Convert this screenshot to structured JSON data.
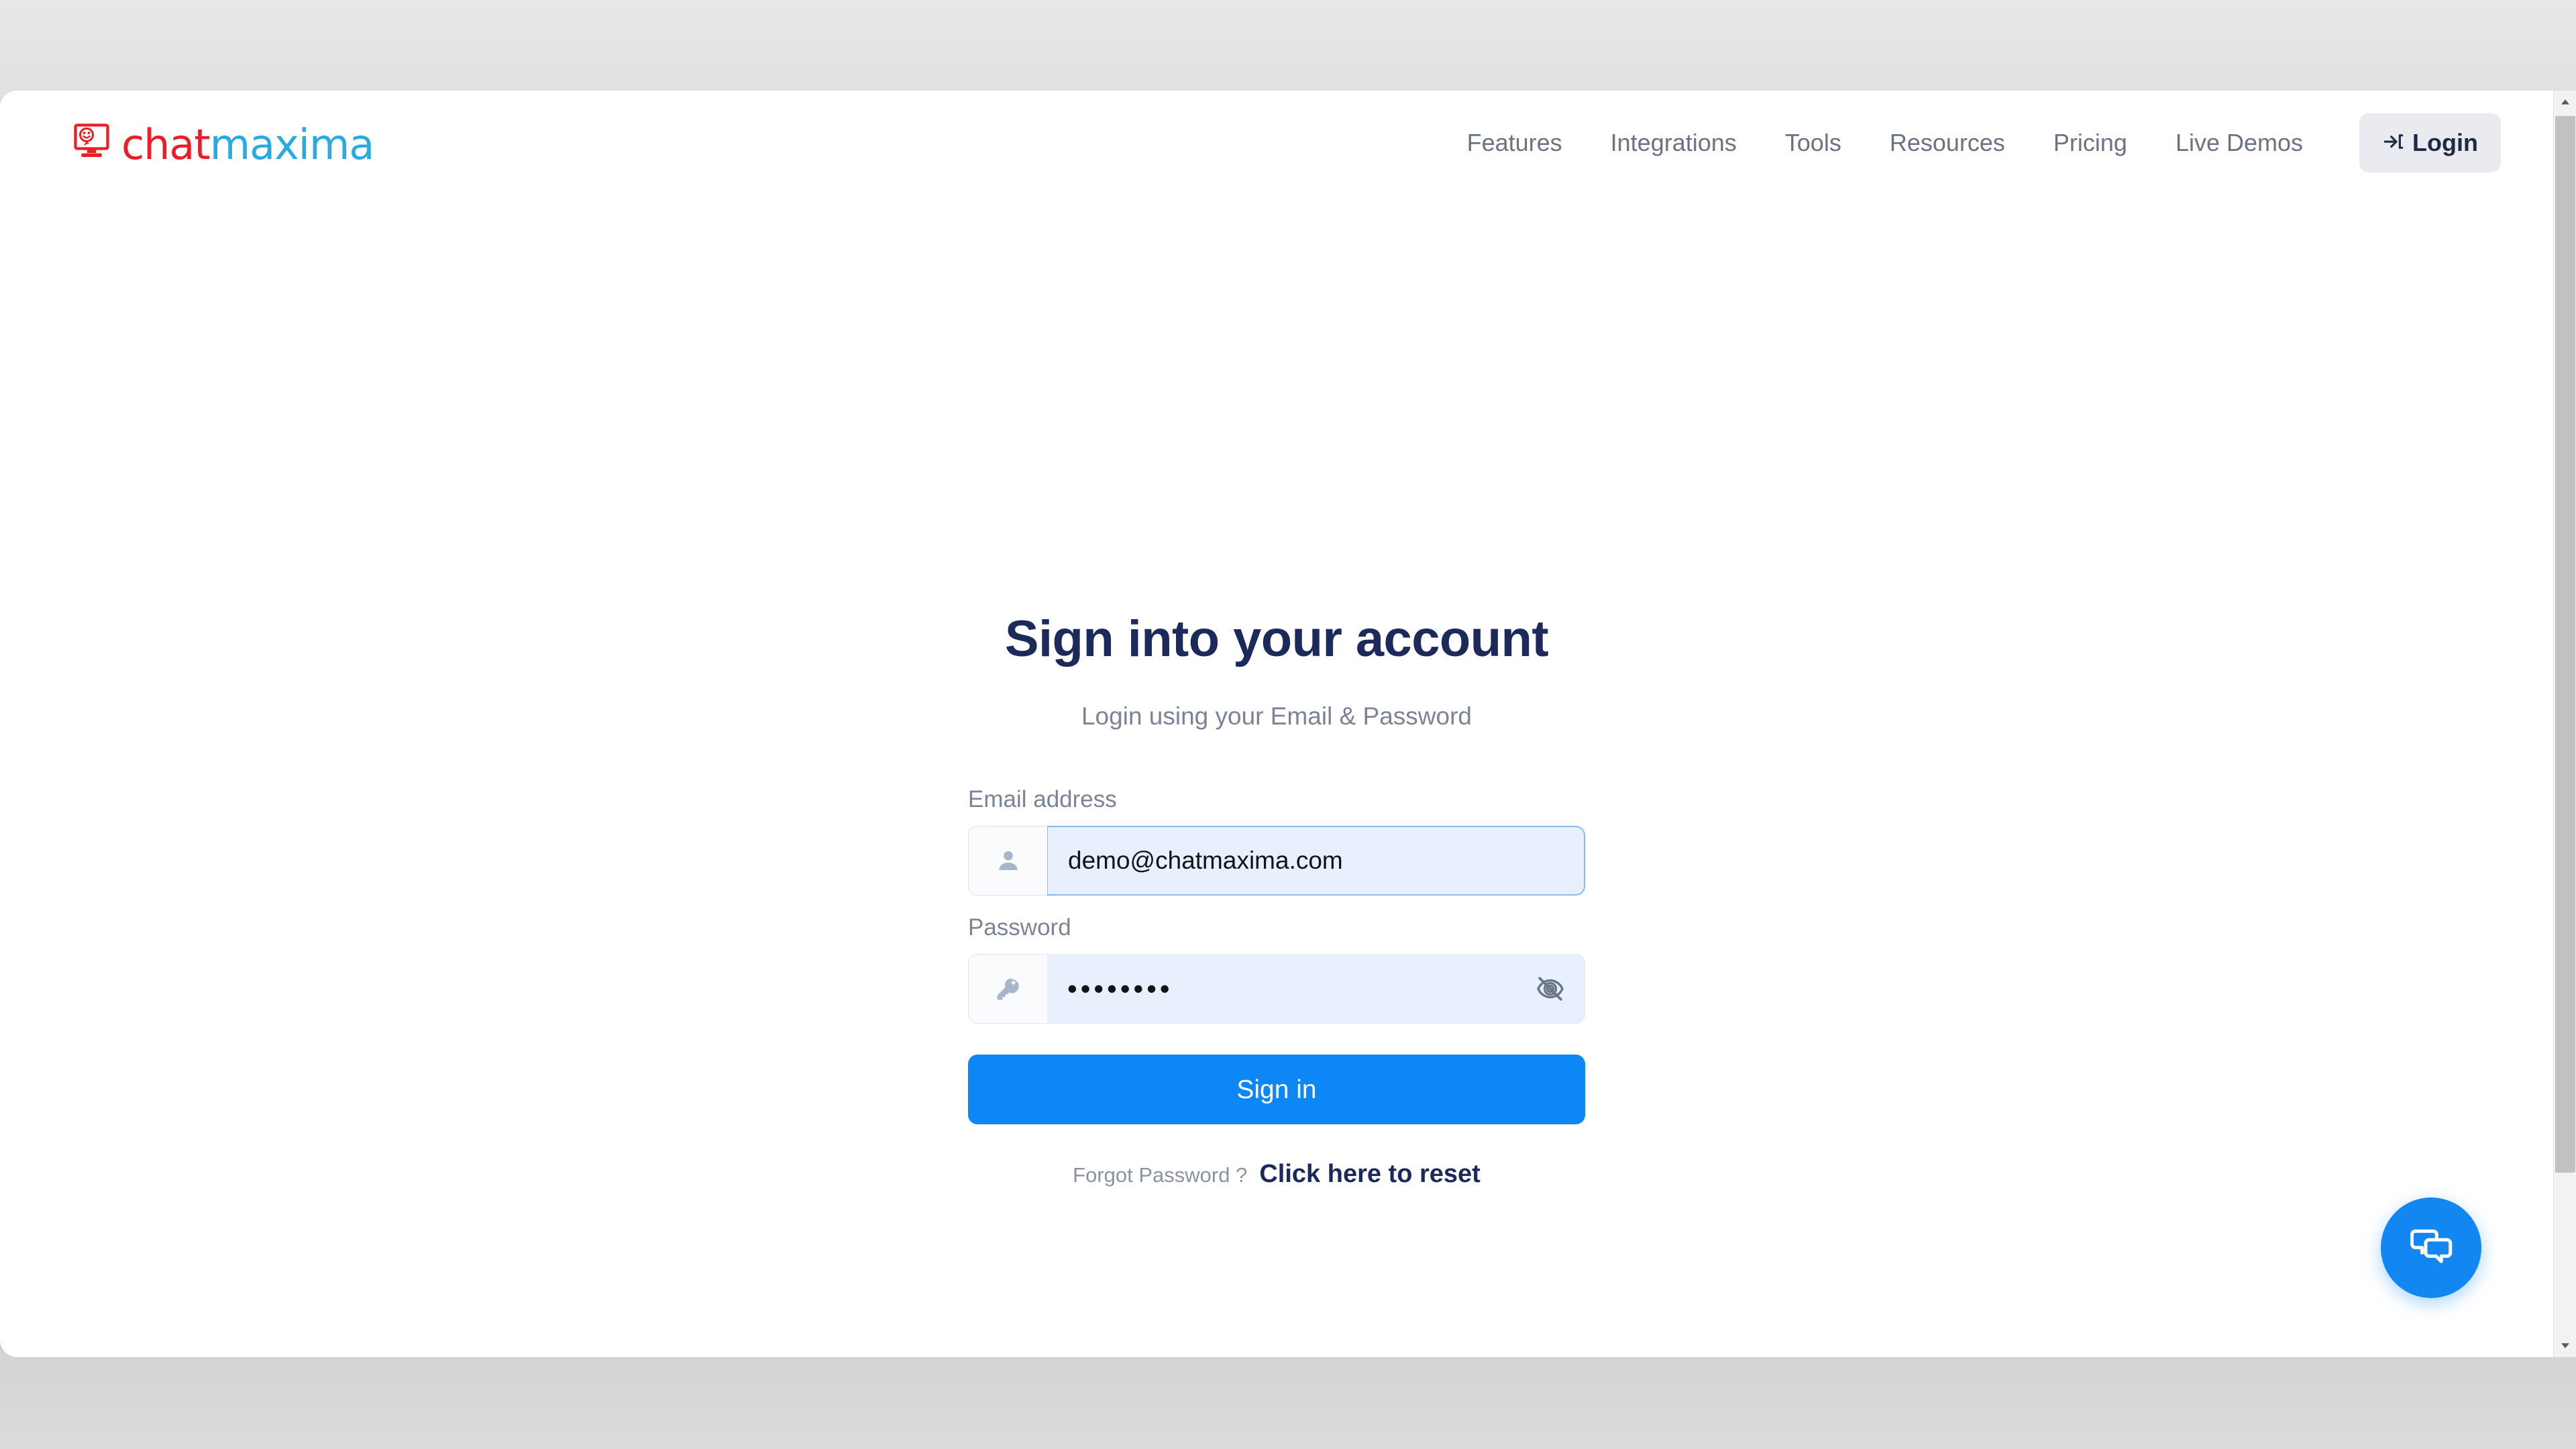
{
  "header": {
    "brand": {
      "logo_icon": "monitor-smiley-icon",
      "word_one": "chat",
      "word_two": "maxima",
      "color_one": "#ef1c26",
      "color_two": "#29aae2"
    },
    "nav_items": [
      {
        "label": "Features",
        "name": "nav-features"
      },
      {
        "label": "Integrations",
        "name": "nav-integrations"
      },
      {
        "label": "Tools",
        "name": "nav-tools"
      },
      {
        "label": "Resources",
        "name": "nav-resources"
      },
      {
        "label": "Pricing",
        "name": "nav-pricing"
      },
      {
        "label": "Live Demos",
        "name": "nav-live-demos"
      }
    ],
    "login_button": {
      "label": "Login",
      "icon": "sign-in-arrow-icon",
      "background": "#e9ebf0"
    }
  },
  "auth": {
    "heading": "Sign into your account",
    "subheading": "Login using your Email & Password",
    "email": {
      "label": "Email address",
      "value": "demo@chatmaxima.com",
      "placeholder": "Email address",
      "prefix_icon": "user-icon",
      "focused": true
    },
    "password": {
      "label": "Password",
      "value": "••••••••",
      "placeholder": "Password",
      "prefix_icon": "key-icon",
      "toggle_icon": "eye-slash-icon",
      "masked": true,
      "length": 8
    },
    "submit_button": {
      "label": "Sign in",
      "background": "#0d87f5"
    },
    "forgot": {
      "text": "Forgot Password ?",
      "link_label": "Click here to reset"
    }
  },
  "chat_widget": {
    "icon": "chat-bubbles-icon",
    "background": "#1287f2"
  },
  "scrollbar": {
    "up_arrow_icon": "chevron-up-icon",
    "down_arrow_icon": "chevron-down-icon"
  }
}
